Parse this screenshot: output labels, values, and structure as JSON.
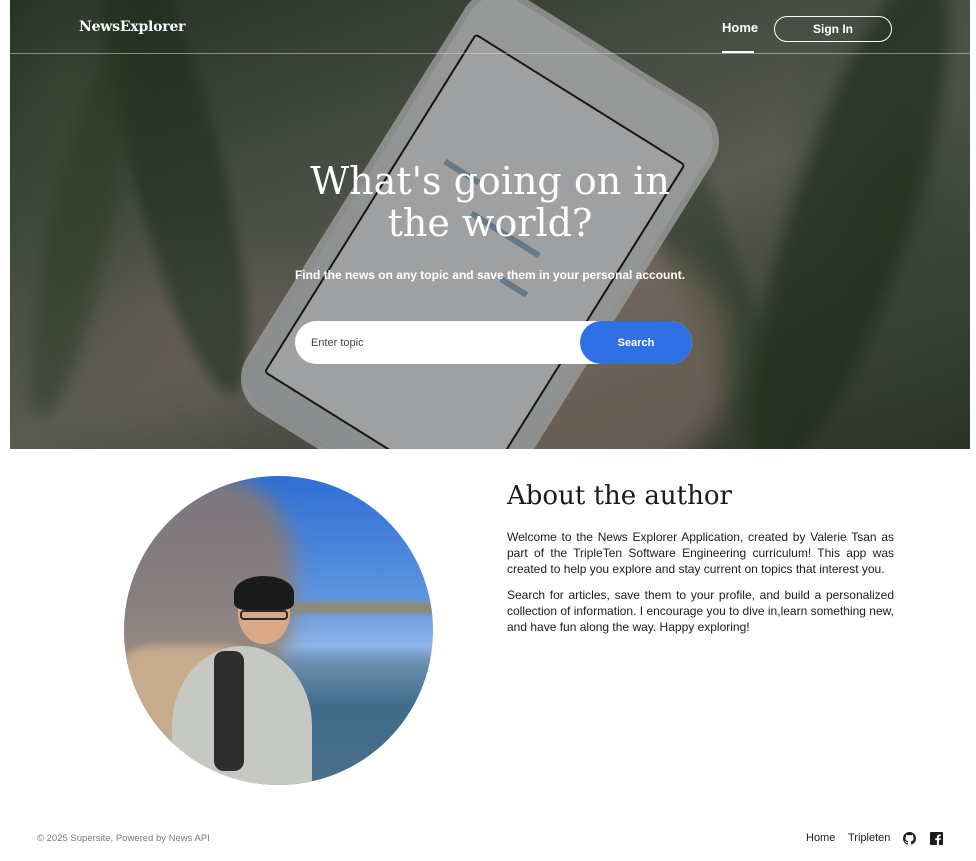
{
  "header": {
    "logo": "NewsExplorer",
    "nav_home": "Home",
    "sign_in": "Sign In"
  },
  "hero": {
    "title": "What's going on in the world?",
    "subtitle": "Find the news on any topic and save them in your personal account.",
    "search": {
      "placeholder": "Enter topic",
      "value": "",
      "button_label": "Search"
    }
  },
  "about": {
    "title": "About the author",
    "paragraphs": [
      "Welcome to the News Explorer Application, created by Valerie Tsan as part of the TripleTen Software Engineering curriculum! This app was created to help you explore and stay current on topics that interest you.",
      "Search for articles, save them to your profile, and build a personalized collection of information. I encourage you to dive in,learn something new, and have fun along the way. Happy exploring!"
    ]
  },
  "footer": {
    "copyright": "© 2025 Supersite, Powered by News API",
    "links": [
      "Home",
      "Tripleten"
    ],
    "icons": [
      "github-icon",
      "facebook-icon"
    ]
  },
  "colors": {
    "accent": "#2f71e5",
    "text": "#1a1b22",
    "muted": "#7a7a7a"
  }
}
